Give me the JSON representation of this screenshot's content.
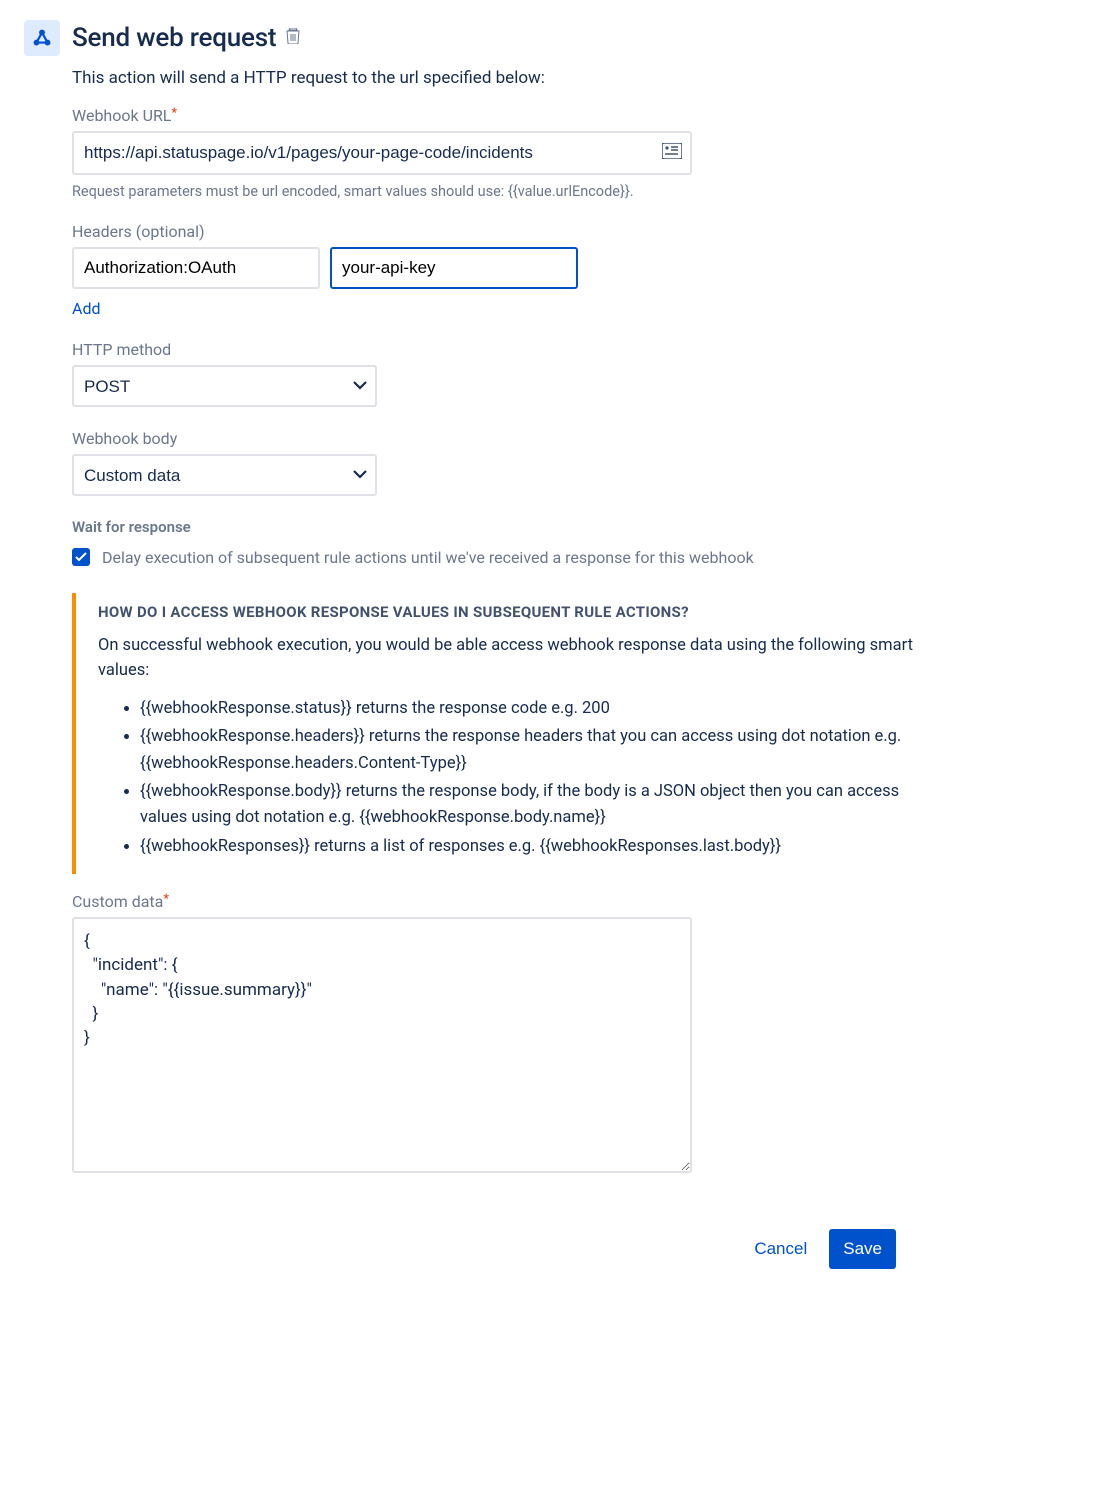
{
  "header": {
    "title": "Send web request"
  },
  "subtitle": "This action will send a HTTP request to the url specified below:",
  "webhook_url": {
    "label": "Webhook URL",
    "value": "https://api.statuspage.io/v1/pages/your-page-code/incidents",
    "helper": "Request parameters must be url encoded, smart values should use: {{value.urlEncode}}."
  },
  "headers": {
    "label": "Headers (optional)",
    "name_value": "Authorization:OAuth",
    "value_value": "your-api-key",
    "add_label": "Add"
  },
  "http_method": {
    "label": "HTTP method",
    "value": "POST"
  },
  "webhook_body": {
    "label": "Webhook body",
    "value": "Custom data"
  },
  "wait": {
    "label": "Wait for response",
    "checkbox_text": "Delay execution of subsequent rule actions until we've received a response for this webhook"
  },
  "info": {
    "heading": "HOW DO I ACCESS WEBHOOK RESPONSE VALUES IN SUBSEQUENT RULE ACTIONS?",
    "intro": "On successful webhook execution, you would be able access webhook response data using the following smart values:",
    "items": [
      "{{webhookResponse.status}} returns the response code e.g. 200",
      "{{webhookResponse.headers}} returns the response headers that you can access using dot notation e.g. {{webhookResponse.headers.Content-Type}}",
      "{{webhookResponse.body}} returns the response body, if the body is a JSON object then you can access values using dot notation e.g. {{webhookResponse.body.name}}",
      "{{webhookResponses}} returns a list of responses e.g. {{webhookResponses.last.body}}"
    ]
  },
  "custom_data": {
    "label": "Custom data",
    "value": "{\n  \"incident\": {\n    \"name\": \"{{issue.summary}}\"\n  }\n}"
  },
  "footer": {
    "cancel": "Cancel",
    "save": "Save"
  }
}
